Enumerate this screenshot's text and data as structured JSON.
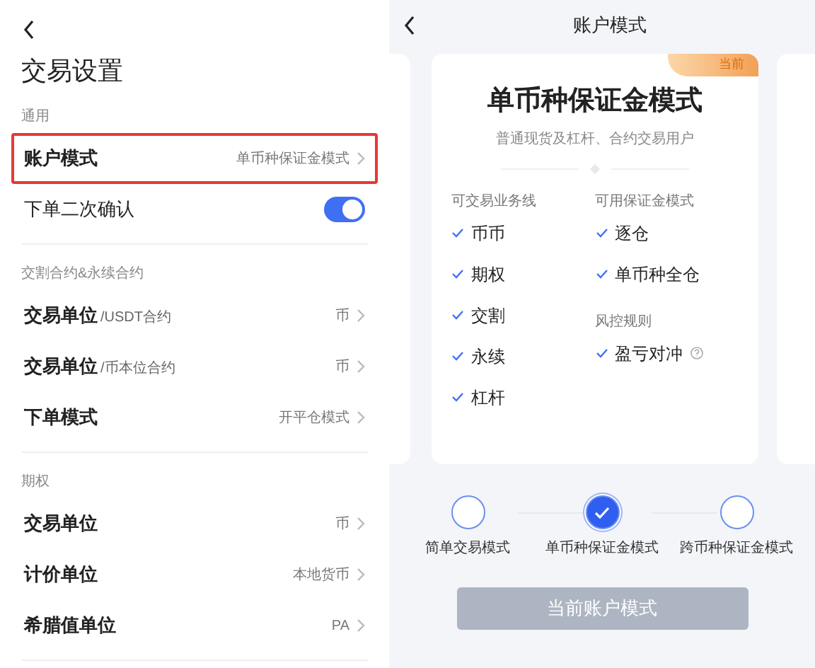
{
  "settings": {
    "title": "交易设置",
    "sections": [
      {
        "title": "通用",
        "items": [
          {
            "kind": "link",
            "label": "账户模式",
            "value": "单币种保证金模式",
            "highlighted": true
          },
          {
            "kind": "toggle",
            "label": "下单二次确认",
            "on": true,
            "highlighted": false
          }
        ]
      },
      {
        "title": "交割合约&永续合约",
        "items": [
          {
            "kind": "link",
            "label": "交易单位",
            "sublabel": "/USDT合约",
            "value": "币",
            "highlighted": false
          },
          {
            "kind": "link",
            "label": "交易单位",
            "sublabel": "/币本位合约",
            "value": "币",
            "highlighted": false
          },
          {
            "kind": "link",
            "label": "下单模式",
            "value": "开平仓模式",
            "highlighted": false
          }
        ]
      },
      {
        "title": "期权",
        "items": [
          {
            "kind": "link",
            "label": "交易单位",
            "value": "币",
            "highlighted": false
          },
          {
            "kind": "link",
            "label": "计价单位",
            "value": "本地货币",
            "highlighted": false
          },
          {
            "kind": "link",
            "label": "希腊值单位",
            "value": "PA",
            "highlighted": false
          }
        ]
      }
    ]
  },
  "account_mode": {
    "title": "账户模式",
    "card": {
      "badge": "当前",
      "title": "单币种保证金模式",
      "subtitle": "普通现货及杠杆、合约交易用户",
      "columns": [
        [
          {
            "heading": "可交易业务线",
            "items": [
              {
                "label": "币币",
                "help": false
              },
              {
                "label": "期权",
                "help": false
              },
              {
                "label": "交割",
                "help": false
              },
              {
                "label": "永续",
                "help": false
              },
              {
                "label": "杠杆",
                "help": false
              }
            ]
          }
        ],
        [
          {
            "heading": "可用保证金模式",
            "items": [
              {
                "label": "逐仓",
                "help": false
              },
              {
                "label": "单币种全仓",
                "help": false
              }
            ]
          },
          {
            "heading": "风控规则",
            "items": [
              {
                "label": "盈亏对冲",
                "help": true
              }
            ]
          }
        ]
      ]
    },
    "steps": [
      {
        "label": "简单交易模式",
        "selected": false
      },
      {
        "label": "单币种保证金模式",
        "selected": true
      },
      {
        "label": "跨币种保证金模式",
        "selected": false
      }
    ],
    "button": {
      "label": "当前账户模式",
      "disabled": true
    }
  }
}
